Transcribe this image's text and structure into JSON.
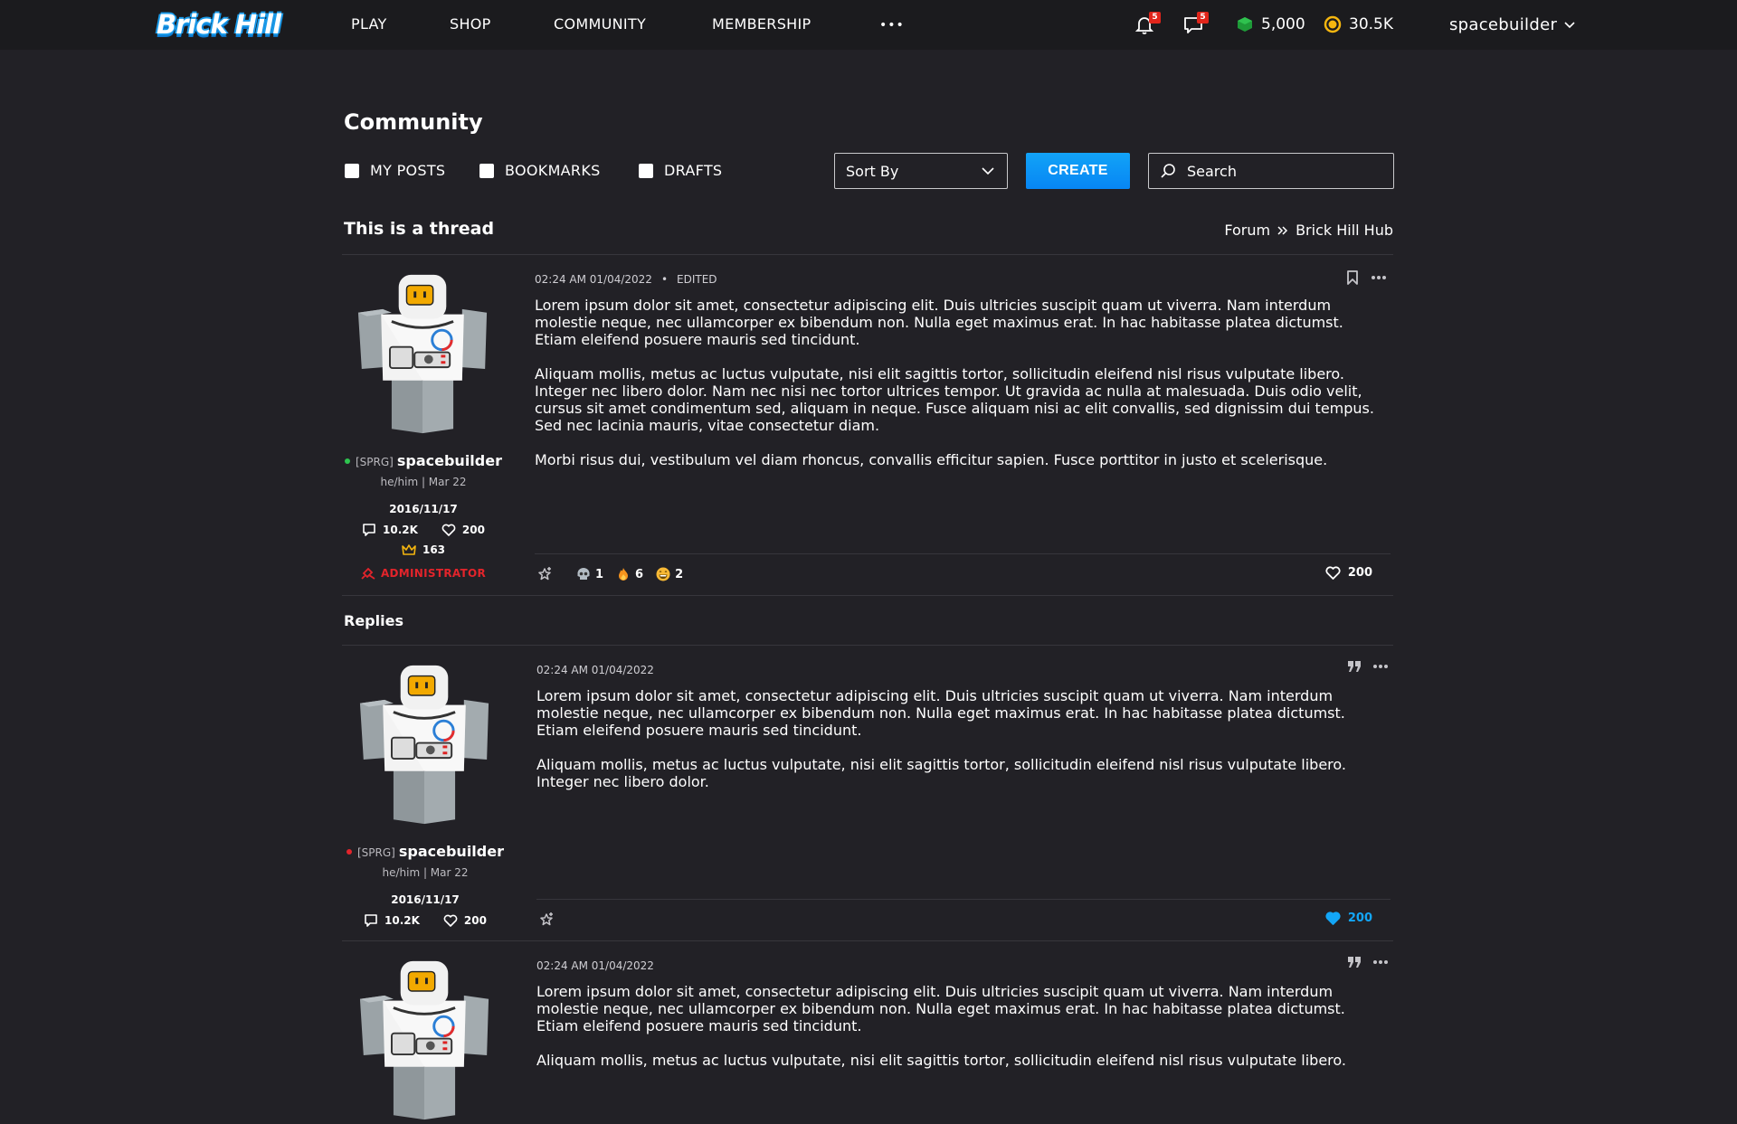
{
  "nav": {
    "logo": "Brick Hill",
    "links": [
      "PLAY",
      "SHOP",
      "COMMUNITY",
      "MEMBERSHIP"
    ],
    "more": "•••",
    "notifications_count": "5",
    "messages_count": "5",
    "bricks": "5,000",
    "bucks": "30.5K",
    "username": "spacebuilder",
    "colors": {
      "bricks": "#22a33b",
      "bucks": "#f5b60f",
      "badge": "#e1251b"
    }
  },
  "header": {
    "title": "Community",
    "filters": [
      "MY POSTS",
      "BOOKMARKS",
      "DRAFTS"
    ],
    "sort_label": "Sort By",
    "create_label": "CREATE",
    "search_placeholder": "Search",
    "accent": "#0b8ff5"
  },
  "thread": {
    "title": "This is a thread",
    "breadcrumb": [
      "Forum",
      "Brick Hill Hub"
    ]
  },
  "replies_label": "Replies",
  "posts": [
    {
      "author": {
        "status": "online",
        "clan": "[SPRG]",
        "name": "spacebuilder",
        "pronouns": "he/him | Mar 22",
        "joined": "2016/11/17",
        "posts": "10.2K",
        "likes": "200",
        "crowns": "163",
        "role": "ADMINISTRATOR"
      },
      "timestamp": "02:24 AM 01/04/2022",
      "edited": "EDITED",
      "paragraphs": [
        "Lorem ipsum dolor sit amet, consectetur adipiscing elit. Duis ultricies suscipit quam ut viverra. Nam interdum molestie neque, nec ullamcorper ex bibendum non. Nulla eget maximus erat. In hac habitasse platea dictumst. Etiam eleifend posuere mauris sed tincidunt.",
        "Aliquam mollis, metus ac luctus vulputate, nisi elit sagittis tortor, sollicitudin eleifend nisl risus vulputate libero. Integer nec libero dolor. Nam nec nisi nec tortor ultrices tempor. Ut gravida ac nulla at malesuada. Duis odio velit, cursus sit amet condimentum sed, aliquam in neque. Fusce aliquam nisi ac elit convallis, sed dignissim dui tempus. Sed nec lacinia mauris, vitae consectetur diam.",
        "Morbi risus dui, vestibulum vel diam rhoncus, convallis efficitur sapien. Fusce porttitor in justo et scelerisque."
      ],
      "reactions": [
        {
          "icon": "skull-icon",
          "count": "1"
        },
        {
          "icon": "fire-icon",
          "count": "6"
        },
        {
          "icon": "grin-icon",
          "count": "2"
        }
      ],
      "likes": "200",
      "liked": false
    },
    {
      "author": {
        "status": "offline",
        "clan": "[SPRG]",
        "name": "spacebuilder",
        "pronouns": "he/him | Mar 22",
        "joined": "2016/11/17",
        "posts": "10.2K",
        "likes": "200"
      },
      "timestamp": "02:24 AM 01/04/2022",
      "paragraphs": [
        "Lorem ipsum dolor sit amet, consectetur adipiscing elit. Duis ultricies suscipit quam ut viverra. Nam interdum molestie neque, nec ullamcorper ex bibendum non. Nulla eget maximus erat. In hac habitasse platea dictumst. Etiam eleifend posuere mauris sed tincidunt.",
        "Aliquam mollis, metus ac luctus vulputate, nisi elit sagittis tortor, sollicitudin eleifend nisl risus vulputate libero. Integer nec libero dolor."
      ],
      "likes": "200",
      "liked": true
    },
    {
      "timestamp": "02:24 AM 01/04/2022",
      "paragraphs": [
        "Lorem ipsum dolor sit amet, consectetur adipiscing elit. Duis ultricies suscipit quam ut viverra. Nam interdum molestie neque, nec ullamcorper ex bibendum non. Nulla eget maximus erat. In hac habitasse platea dictumst. Etiam eleifend posuere mauris sed tincidunt.",
        "Aliquam mollis, metus ac luctus vulputate, nisi elit sagittis tortor, sollicitudin eleifend nisl risus vulputate libero."
      ]
    }
  ]
}
